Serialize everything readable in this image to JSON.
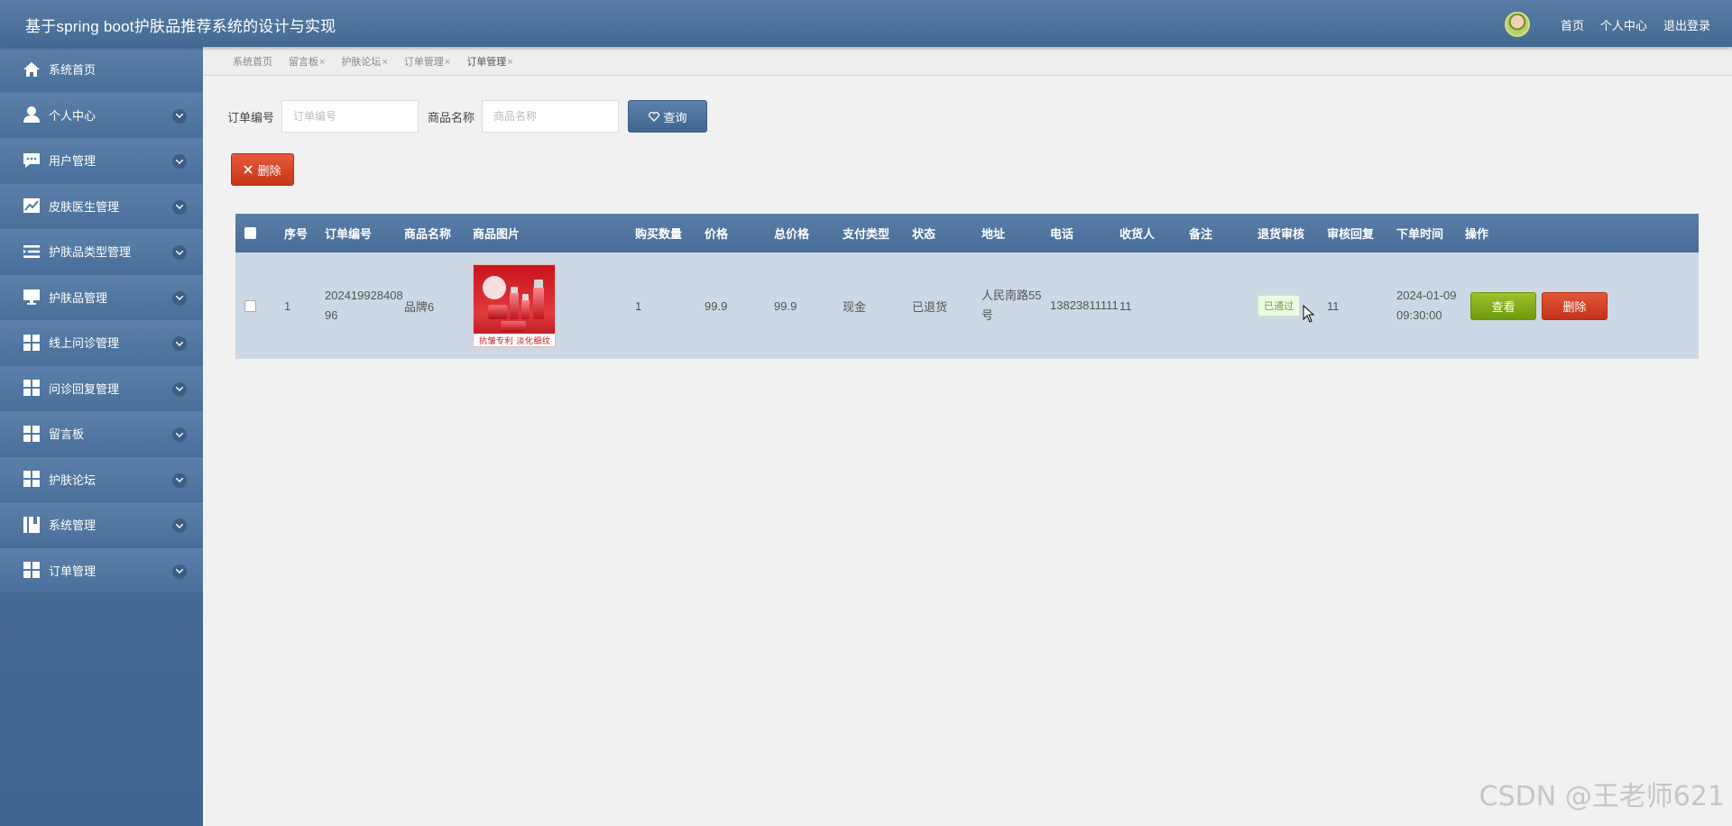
{
  "app": {
    "title": "基于spring boot护肤品推荐系统的设计与实现"
  },
  "header": {
    "links": {
      "home": "首页",
      "profile": "个人中心",
      "logout": "退出登录"
    }
  },
  "sidebar": {
    "items": [
      {
        "label": "系统首页",
        "icon": "home-icon"
      },
      {
        "label": "个人中心",
        "icon": "user-icon"
      },
      {
        "label": "用户管理",
        "icon": "chat-icon"
      },
      {
        "label": "皮肤医生管理",
        "icon": "chart-icon"
      },
      {
        "label": "护肤品类型管理",
        "icon": "list-icon"
      },
      {
        "label": "护肤品管理",
        "icon": "monitor-icon"
      },
      {
        "label": "线上问诊管理",
        "icon": "grid-icon"
      },
      {
        "label": "问诊回复管理",
        "icon": "grid-icon"
      },
      {
        "label": "留言板",
        "icon": "grid-icon"
      },
      {
        "label": "护肤论坛",
        "icon": "grid-icon"
      },
      {
        "label": "系统管理",
        "icon": "book-icon"
      },
      {
        "label": "订单管理",
        "icon": "grid-icon"
      }
    ]
  },
  "tabs": [
    {
      "label": "系统首页",
      "closable": false
    },
    {
      "label": "留言板",
      "closable": true
    },
    {
      "label": "护肤论坛",
      "closable": true
    },
    {
      "label": "订单管理",
      "closable": true
    },
    {
      "label": "订单管理",
      "closable": true,
      "active": true
    }
  ],
  "search": {
    "order_no_label": "订单编号",
    "order_no_placeholder": "订单编号",
    "product_label": "商品名称",
    "product_placeholder": "商品名称",
    "query_button": "查询"
  },
  "actions": {
    "delete_button": "删除"
  },
  "table": {
    "headers": [
      "序号",
      "订单编号",
      "商品名称",
      "商品图片",
      "购买数量",
      "价格",
      "总价格",
      "支付类型",
      "状态",
      "地址",
      "电话",
      "收货人",
      "备注",
      "退货审核",
      "审核回复",
      "下单时间",
      "操作"
    ],
    "rows": [
      {
        "seq": "1",
        "order_no": "20241992840896",
        "product_name": "品牌6",
        "image_caption": "抗皱专利 淡化细纹",
        "quantity": "1",
        "price": "99.9",
        "total": "99.9",
        "payment": "现金",
        "status": "已退货",
        "address": "人民南路55号",
        "phone": "13823811111",
        "receiver": "11",
        "note": "",
        "review": "已通过",
        "reply": "11",
        "order_time": "2024-01-09 09:30:00",
        "view_button": "查看",
        "delete_button": "删除"
      }
    ]
  },
  "watermark": "CSDN @王老师621",
  "colors": {
    "header": "#4d729c",
    "sidebar": "#4a6f9a",
    "primary_button": "#4d729c",
    "danger_button": "#d5431f",
    "view_button": "#88ad1c",
    "pass_badge": "#6aa83e"
  }
}
